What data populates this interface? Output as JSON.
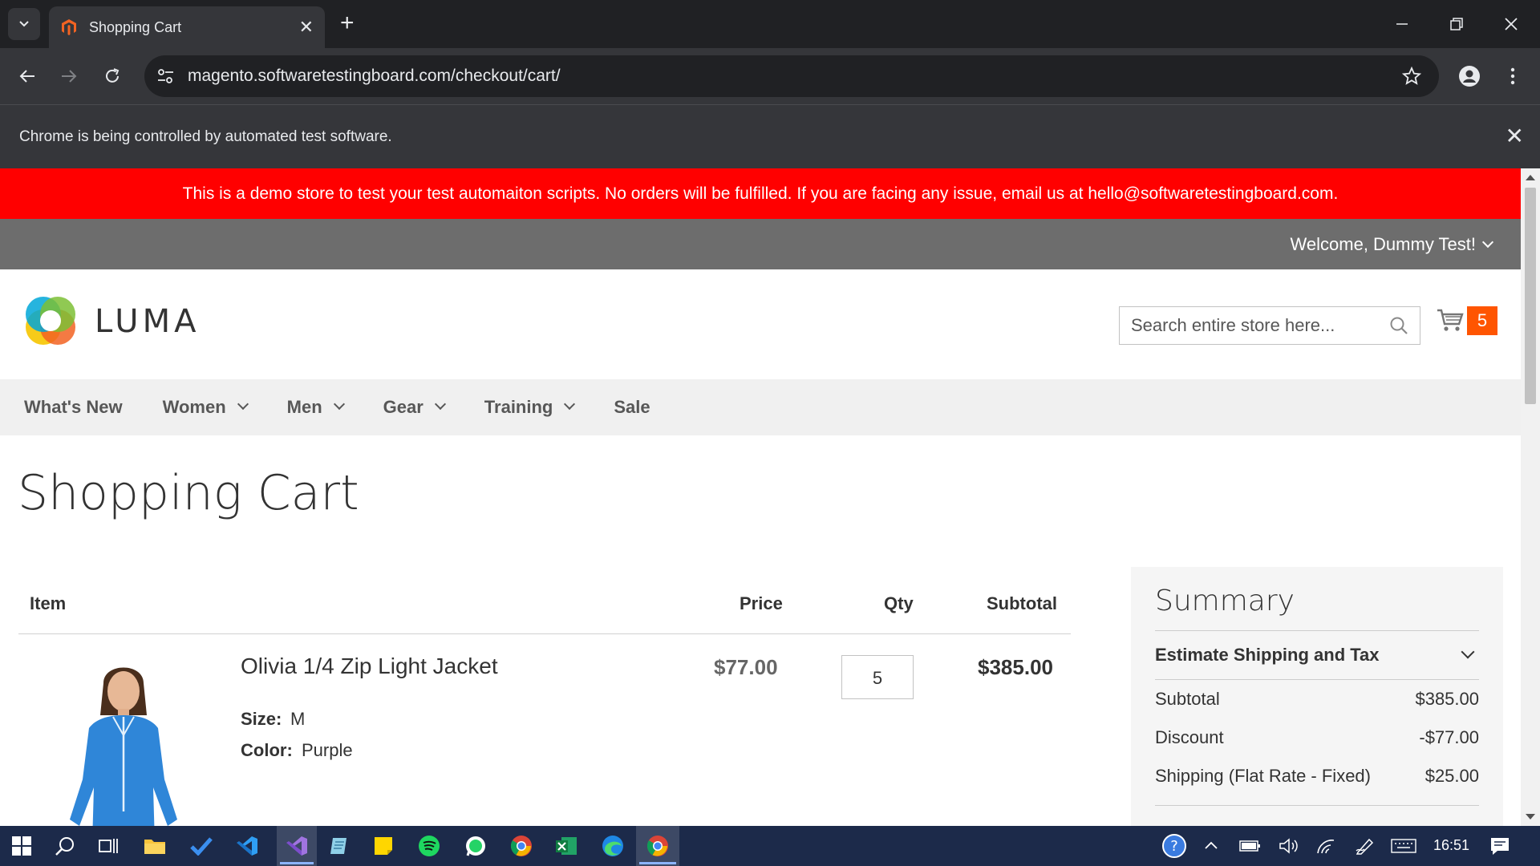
{
  "browser": {
    "tab_title": "Shopping Cart",
    "url": "magento.softwaretestingboard.com/checkout/cart/",
    "infobar_message": "Chrome is being controlled by automated test software."
  },
  "store": {
    "demo_notice": "This is a demo store to test your test automaiton scripts. No orders will be fulfilled. If you are facing any issue, email us at hello@softwaretestingboard.com.",
    "welcome": "Welcome, Dummy Test!",
    "logo_text": "LUMA",
    "search_placeholder": "Search entire store here...",
    "cart_count": "5",
    "nav": [
      {
        "label": "What's New",
        "has_dropdown": false
      },
      {
        "label": "Women",
        "has_dropdown": true
      },
      {
        "label": "Men",
        "has_dropdown": true
      },
      {
        "label": "Gear",
        "has_dropdown": true
      },
      {
        "label": "Training",
        "has_dropdown": true
      },
      {
        "label": "Sale",
        "has_dropdown": false
      }
    ]
  },
  "cart": {
    "page_title": "Shopping Cart",
    "headers": {
      "item": "Item",
      "price": "Price",
      "qty": "Qty",
      "subtotal": "Subtotal"
    },
    "items": [
      {
        "name": "Olivia 1/4 Zip Light Jacket",
        "size_label": "Size:",
        "size": "M",
        "color_label": "Color:",
        "color": "Purple",
        "price": "$77.00",
        "qty": "5",
        "subtotal": "$385.00"
      }
    ]
  },
  "summary": {
    "title": "Summary",
    "estimate_label": "Estimate Shipping and Tax",
    "rows": [
      {
        "label": "Subtotal",
        "value": "$385.00"
      },
      {
        "label": "Discount",
        "value": "-$77.00"
      },
      {
        "label": "Shipping (Flat Rate - Fixed)",
        "value": "$25.00"
      }
    ]
  },
  "taskbar": {
    "time": "16:51",
    "apps": [
      "start-icon",
      "search-icon",
      "task-view-icon",
      "file-explorer-icon",
      "todo-icon",
      "vscode-icon",
      "visual-studio-icon",
      "notepad-icon",
      "sticky-notes-icon",
      "spotify-icon",
      "whatsapp-icon",
      "chrome-icon",
      "excel-icon",
      "edge-icon",
      "chrome-active-icon"
    ]
  },
  "colors": {
    "demo_banner": "#ff0000",
    "cart_counter": "#ff5501",
    "panel_header": "#6d6d6d",
    "nav_bg": "#f0f0f0",
    "summary_bg": "#f5f5f5"
  }
}
